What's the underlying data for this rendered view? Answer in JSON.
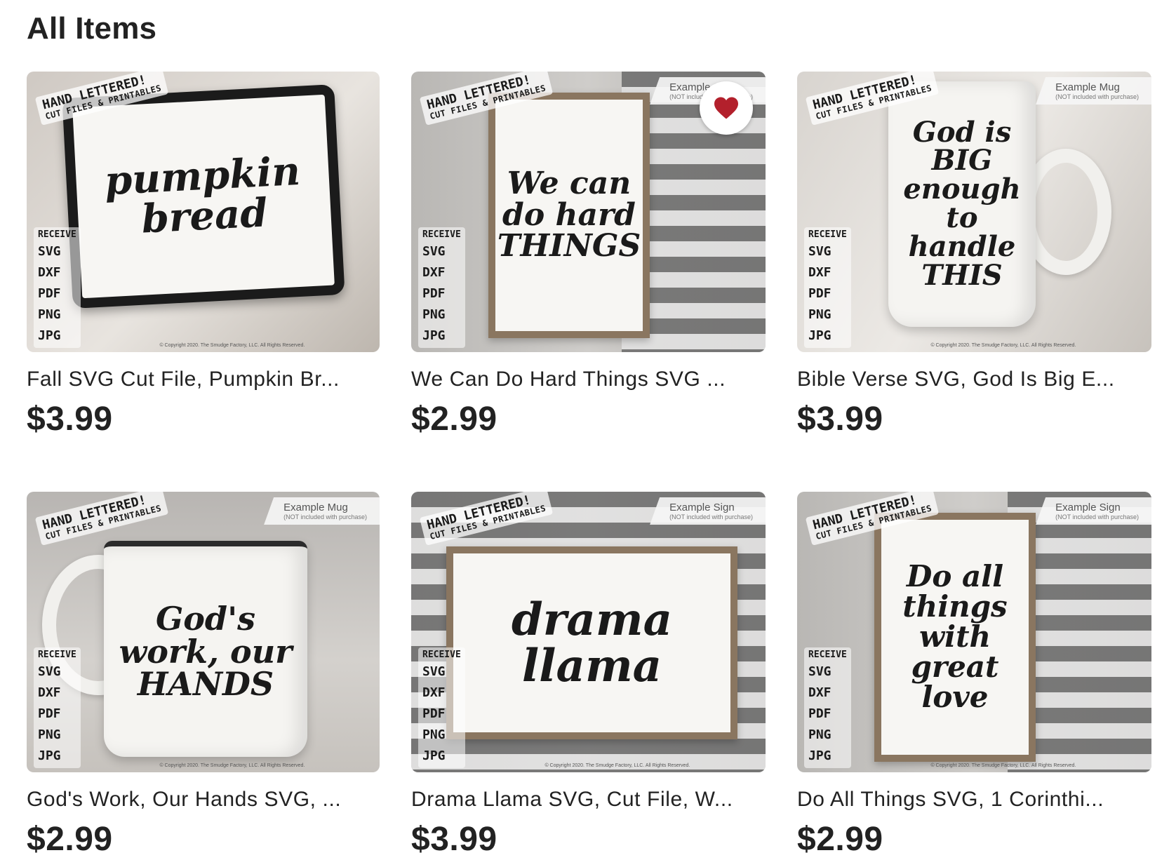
{
  "heading": "All Items",
  "badge": {
    "line1": "HAND LETTERED!",
    "line2": "CUT FILES & PRINTABLES",
    "receive": "RECEIVE",
    "formats": [
      "SVG",
      "DXF",
      "PDF",
      "PNG",
      "JPG"
    ]
  },
  "copyright": "© Copyright 2020. The Smudge Factory, LLC. All Rights Reserved.",
  "items": [
    {
      "title": "Fall SVG Cut File, Pumpkin Br...",
      "price": "$3.99",
      "lettering": "pumpkin bread",
      "favorited": false
    },
    {
      "title": "We Can Do Hard Things SVG ...",
      "price": "$2.99",
      "lettering": "We can do hard THINGS",
      "example_tag": "Example Sign",
      "example_sub": "(NOT included with purchase)",
      "favorited": true
    },
    {
      "title": "Bible Verse SVG, God Is Big E...",
      "price": "$3.99",
      "lettering": "God is BIG enough to handle THIS",
      "example_tag": "Example Mug",
      "example_sub": "(NOT included with purchase)",
      "favorited": false
    },
    {
      "title": "God's Work, Our Hands SVG, ...",
      "price": "$2.99",
      "lettering": "God's work, our HANDS",
      "example_tag": "Example Mug",
      "example_sub": "(NOT included with purchase)",
      "favorited": false
    },
    {
      "title": "Drama Llama SVG, Cut File, W...",
      "price": "$3.99",
      "lettering": "drama llama",
      "example_tag": "Example Sign",
      "example_sub": "(NOT included with purchase)",
      "favorited": false
    },
    {
      "title": "Do All Things SVG, 1 Corinthi...",
      "price": "$2.99",
      "lettering": "Do all things with great love",
      "example_tag": "Example Sign",
      "example_sub": "(NOT included with purchase)",
      "favorited": false
    }
  ],
  "colors": {
    "text": "#222222",
    "favorite_heart": "#b3202c",
    "frame_wood": "#8a7660"
  }
}
